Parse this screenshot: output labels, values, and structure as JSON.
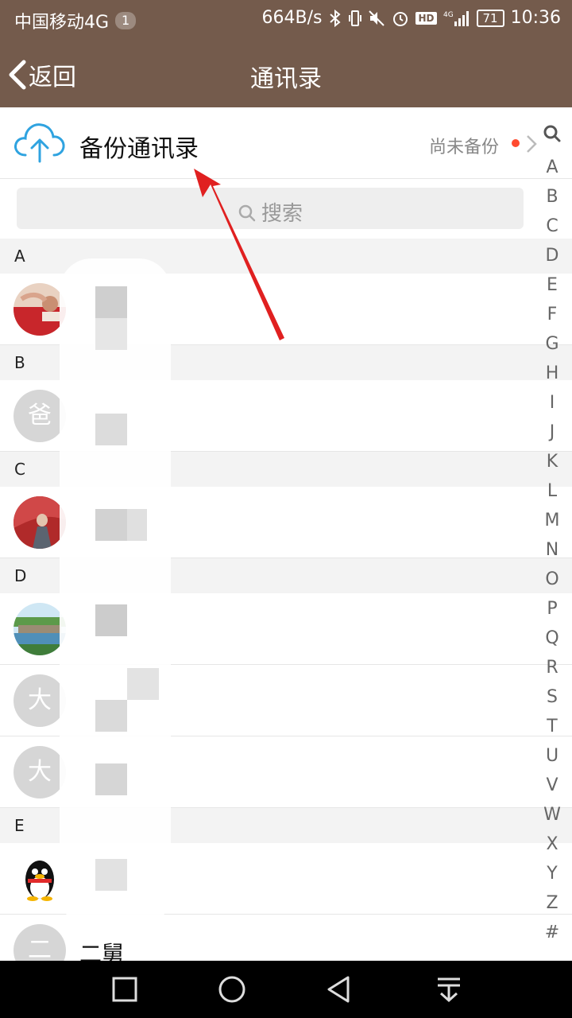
{
  "status_bar": {
    "carrier": "中国移动4G",
    "badge": "1",
    "speed": "664B/s",
    "hd": "HD",
    "signal_label": "4G",
    "battery": "71",
    "time": "10:36"
  },
  "nav": {
    "back_label": "返回",
    "title": "通讯录"
  },
  "backup": {
    "title": "备份通讯录",
    "status": "尚未备份"
  },
  "search": {
    "placeholder": "搜索"
  },
  "sections": [
    {
      "letter": "A"
    },
    {
      "letter": "B"
    },
    {
      "letter": "C"
    },
    {
      "letter": "D"
    },
    {
      "letter": "E"
    }
  ],
  "contacts": [
    {
      "avatar_text": "",
      "name": ""
    },
    {
      "avatar_text": "爸",
      "name": ""
    },
    {
      "avatar_text": "",
      "name": ""
    },
    {
      "avatar_text": "",
      "name": ""
    },
    {
      "avatar_text": "大",
      "name": ""
    },
    {
      "avatar_text": "大",
      "name": ""
    },
    {
      "avatar_text": "",
      "name": ""
    },
    {
      "avatar_text": "二",
      "name": "二舅"
    }
  ],
  "index_letters": [
    "A",
    "B",
    "C",
    "D",
    "E",
    "F",
    "G",
    "H",
    "I",
    "J",
    "K",
    "L",
    "M",
    "N",
    "O",
    "P",
    "Q",
    "R",
    "S",
    "T",
    "U",
    "V",
    "W",
    "X",
    "Y",
    "Z",
    "#"
  ],
  "colors": {
    "header_bg": "#745b4c",
    "accent_blue": "#2fa3e0",
    "dot_red": "#ff4a2f",
    "arrow_red": "#e02020"
  }
}
